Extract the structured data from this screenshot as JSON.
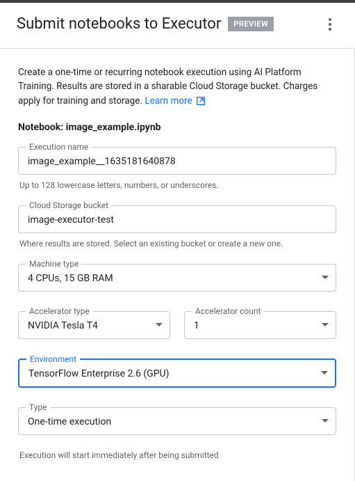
{
  "header": {
    "title": "Submit notebooks to Executor",
    "badge": "PREVIEW"
  },
  "description": {
    "text": "Create a one-time or recurring notebook execution using AI Platform Training. Results are stored in a sharable Cloud Storage bucket. Charges apply for training and storage. ",
    "link": "Learn more"
  },
  "notebook": {
    "label_prefix": "Notebook: ",
    "name": "image_example.ipynb"
  },
  "fields": {
    "execution_name": {
      "label": "Execution name",
      "value": "image_example__1635181640878",
      "helper": "Up to 128 lowercase letters, numbers, or underscores."
    },
    "bucket": {
      "label": "Cloud Storage bucket",
      "value": "image-executor-test",
      "helper": "Where results are stored. Select an existing bucket or create a new one."
    },
    "machine_type": {
      "label": "Machine type",
      "value": "4 CPUs, 15 GB RAM"
    },
    "accel_type": {
      "label": "Accelerator type",
      "value": "NVIDIA Tesla T4"
    },
    "accel_count": {
      "label": "Accelerator count",
      "value": "1"
    },
    "environment": {
      "label": "Environment",
      "value": "TensorFlow Enterprise 2.6 (GPU)"
    },
    "type": {
      "label": "Type",
      "value": "One-time execution"
    }
  },
  "footer_note": "Execution will start immediately after being submitted"
}
